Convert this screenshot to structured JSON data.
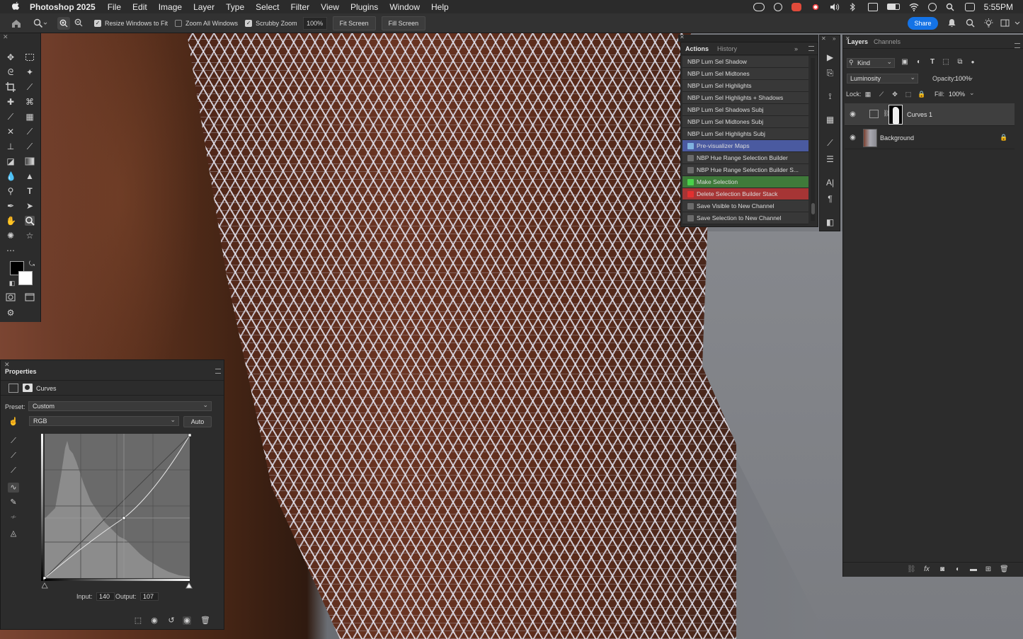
{
  "menubar": {
    "app_name": "Photoshop 2025",
    "items": [
      "File",
      "Edit",
      "Image",
      "Layer",
      "Type",
      "Select",
      "Filter",
      "View",
      "Plugins",
      "Window",
      "Help"
    ],
    "clock": "5:55PM"
  },
  "options_bar": {
    "resize_windows_label": "Resize Windows to Fit",
    "resize_windows_checked": true,
    "zoom_all_windows_label": "Zoom All Windows",
    "zoom_all_windows_checked": false,
    "scrubby_zoom_label": "Scrubby Zoom",
    "scrubby_zoom_checked": true,
    "zoom_value": "100%",
    "fit_screen_label": "Fit Screen",
    "fill_screen_label": "Fill Screen",
    "share_label": "Share"
  },
  "properties": {
    "title": "Properties",
    "adjustment_type": "Curves",
    "preset_label": "Preset:",
    "preset_value": "Custom",
    "channel_value": "RGB",
    "auto_label": "Auto",
    "input_label": "Input:",
    "input_value": "140",
    "output_label": "Output:",
    "output_value": "107"
  },
  "actions_panel": {
    "tabs": [
      "Actions",
      "History"
    ],
    "items": [
      {
        "label": "NBP Lum Sel Shadow",
        "style": "plain"
      },
      {
        "label": "NBP Lum Sel Midtones",
        "style": "plain"
      },
      {
        "label": "NBP Lum Sel Highlights",
        "style": "plain"
      },
      {
        "label": "NBP Lum Sel Highlights + Shadows",
        "style": "plain"
      },
      {
        "label": "NBP Lum Sel Shadows Subj",
        "style": "plain"
      },
      {
        "label": "NBP Lum Sel Midtones Subj",
        "style": "plain"
      },
      {
        "label": "NBP Lum Sel Highlights Subj",
        "style": "plain"
      },
      {
        "label": "Pre-visualizer Maps",
        "style": "blue"
      },
      {
        "label": "NBP Hue Range Selection Builder",
        "style": "plain"
      },
      {
        "label": "NBP Hue Range Selection Builder S...",
        "style": "plain"
      },
      {
        "label": "Make Selection",
        "style": "green"
      },
      {
        "label": "Delete Selection Builder Stack",
        "style": "red"
      },
      {
        "label": "Save Visible to New Channel",
        "style": "plain"
      },
      {
        "label": "Save Selection to New Channel",
        "style": "plain"
      }
    ]
  },
  "layers_panel": {
    "tabs": [
      "Layers",
      "Channels"
    ],
    "kind_label": "Kind",
    "blend_mode": "Luminosity",
    "opacity_label": "Opacity:",
    "opacity_value": "100%",
    "lock_label": "Lock:",
    "fill_label": "Fill:",
    "fill_value": "100%",
    "layers": [
      {
        "name": "Curves 1",
        "selected": true
      },
      {
        "name": "Background",
        "selected": false,
        "locked": true
      }
    ]
  },
  "colors": {
    "accent": "#1473e6",
    "foreground_color": "#000000",
    "background_color": "#ffffff"
  }
}
